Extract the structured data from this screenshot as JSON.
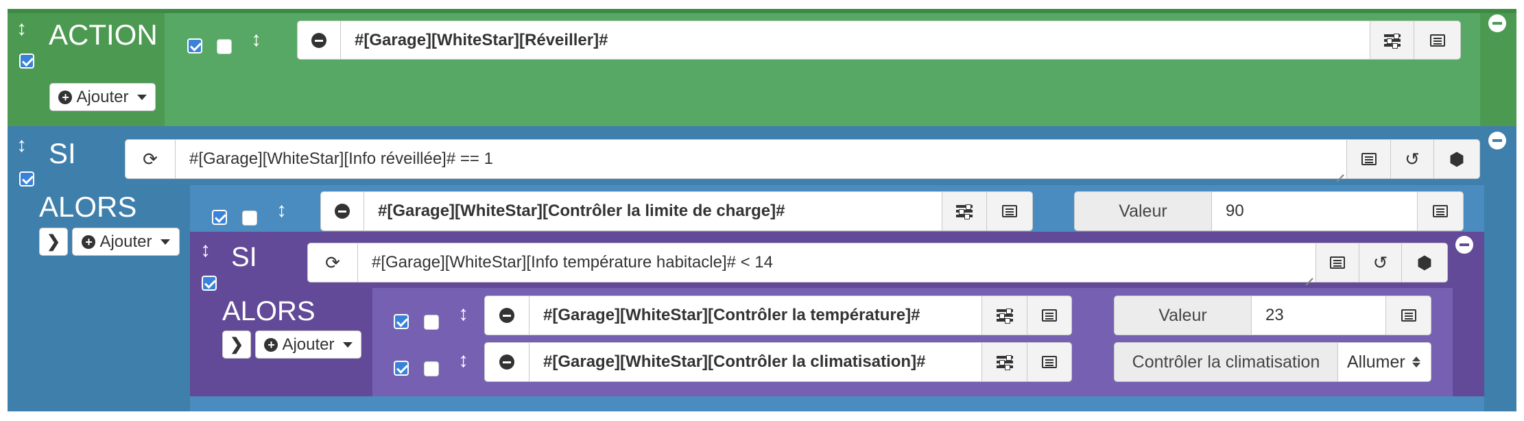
{
  "action_block": {
    "title": "ACTION",
    "add_label": "Ajouter",
    "command": "#[Garage][WhiteStar][Réveiller]#"
  },
  "si_block": {
    "title": "SI",
    "condition": "#[Garage][WhiteStar][Info réveillée]# == 1",
    "then_title": "ALORS",
    "add_label": "Ajouter",
    "action": {
      "command": "#[Garage][WhiteStar][Contrôler la limite de charge]#",
      "param_label": "Valeur",
      "param_value": "90"
    }
  },
  "si_nested": {
    "title": "SI",
    "condition": "#[Garage][WhiteStar][Info température habitacle]# < 14",
    "then_title": "ALORS",
    "add_label": "Ajouter",
    "actions": [
      {
        "command": "#[Garage][WhiteStar][Contrôler la température]#",
        "param_label": "Valeur",
        "param_value": "23"
      },
      {
        "command": "#[Garage][WhiteStar][Contrôler la climatisation]#",
        "param_label": "Contrôler la climatisation",
        "select_value": "Allumer"
      }
    ]
  },
  "colors": {
    "action_green": "#57a864",
    "si_blue": "#3f7fac",
    "si_purple": "#634a98",
    "alors_purple": "#7560b2",
    "checkbox_blue": "#3a82d8"
  }
}
